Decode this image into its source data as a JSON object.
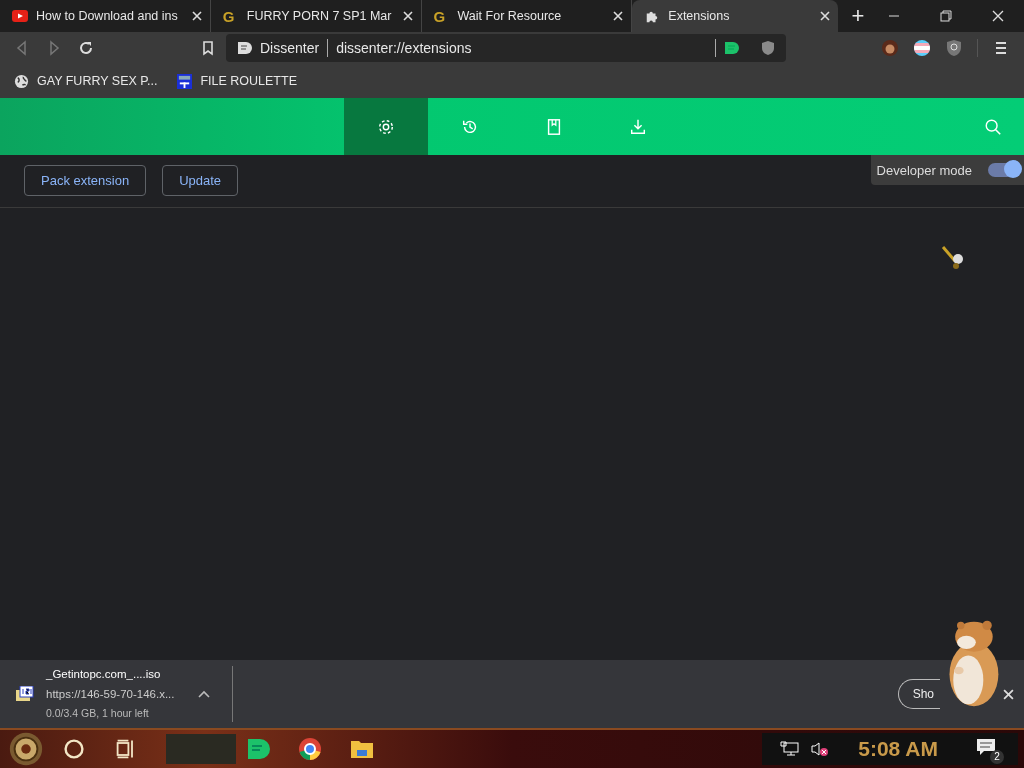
{
  "tabs": [
    {
      "title": "How to Download and ins",
      "kind": "video",
      "selected": false
    },
    {
      "title": "FURRY PORN 7 SP1 Mar",
      "kind": "letter",
      "icon_text": "G",
      "selected": false
    },
    {
      "title": "Wait For Resource",
      "kind": "letter",
      "icon_text": "G",
      "selected": false
    },
    {
      "title": "Extensions",
      "kind": "puzzle",
      "selected": true
    }
  ],
  "new_tab": "+",
  "address_bar": {
    "site": "Dissenter",
    "url": "dissenter://extensions"
  },
  "bookmarks": [
    {
      "title": "GAY FURRY SEX P...",
      "kind": "globe"
    },
    {
      "title": "FILE ROULETTE",
      "kind": "badge"
    }
  ],
  "nav": [
    {
      "kind": "gear",
      "selected": true
    },
    {
      "kind": "history",
      "selected": false
    },
    {
      "kind": "book",
      "selected": false
    },
    {
      "kind": "download",
      "selected": false
    }
  ],
  "actions": [
    "Pack extension",
    "Update"
  ],
  "developer_mode": {
    "label": "Developer mode",
    "on": true
  },
  "download": {
    "filename": "_Getintopc.com_....iso",
    "source": "https://146-59-70-146.x...",
    "progress": "0.0/3.4 GB, 1 hour left",
    "show_button": "Sho"
  },
  "taskbar": {
    "time": "5:08 AM",
    "notifications": "2"
  }
}
